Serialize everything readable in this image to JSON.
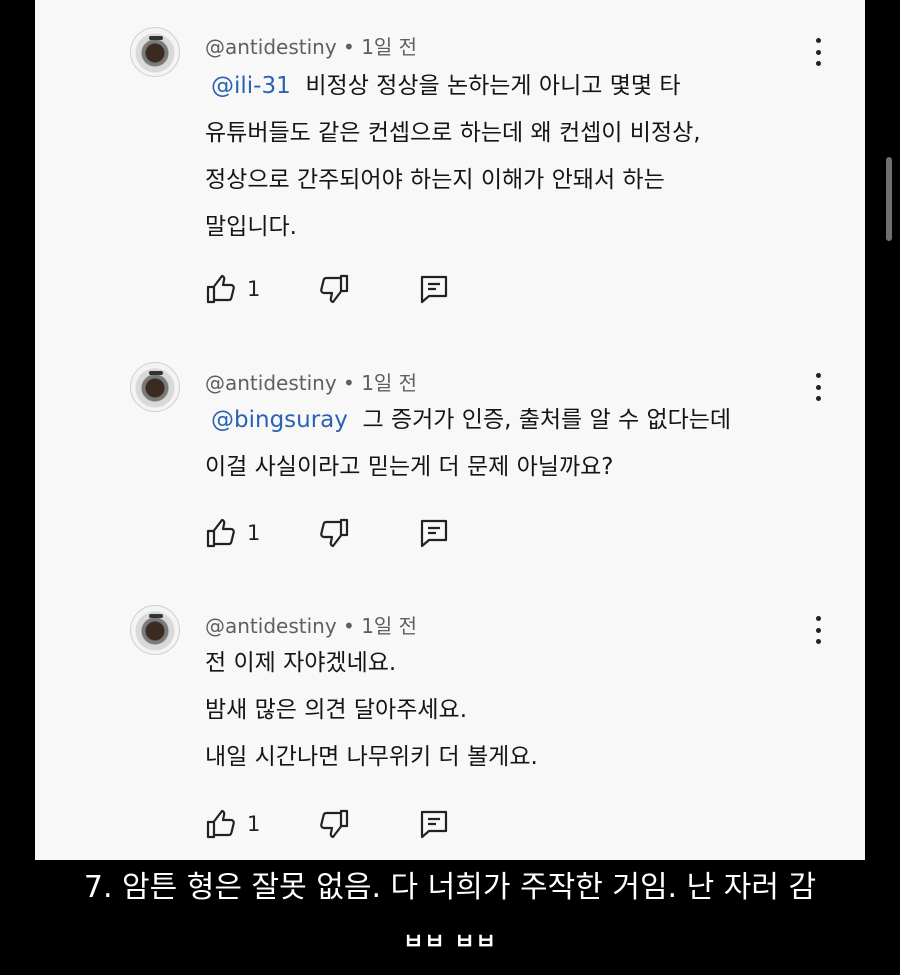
{
  "comments": [
    {
      "author": "@antidestiny",
      "time": "1일 전",
      "mention": "@ili-31",
      "lines": [
        "비정상 정상을 논하는게 아니고 몇몇 타",
        "유튜버들도 같은 컨셉으로 하는데 왜 컨셉이 비정상,",
        "정상으로 간주되어야 하는지 이해가 안돼서 하는",
        "말입니다."
      ],
      "likes": "1"
    },
    {
      "author": "@antidestiny",
      "time": "1일 전",
      "mention": "@bingsuray",
      "lines": [
        "그 증거가 인증, 출처를 알 수 없다는데",
        "이걸 사실이라고 믿는게 더 문제 아닐까요?"
      ],
      "likes": "1"
    },
    {
      "author": "@antidestiny",
      "time": "1일 전",
      "mention": "",
      "lines": [
        "전 이제 자야겠네요.",
        "밤새 많은 의견 달아주세요.",
        "내일 시간나면 나무위키 더 볼게요."
      ],
      "likes": "1"
    }
  ],
  "meta_separator": "•",
  "caption": "7. 암튼 형은 잘못 없음. 다 너희가 주작한 거임. 난 자러 감",
  "caption2": "ㅂㅂ ㅂㅂ",
  "icons": [
    "thumbs-up-icon",
    "thumbs-down-icon",
    "reply-icon",
    "more-vert-icon"
  ],
  "colors": {
    "mention": "#2a62b4",
    "panel": "#f8f8f8",
    "background": "#000000"
  }
}
